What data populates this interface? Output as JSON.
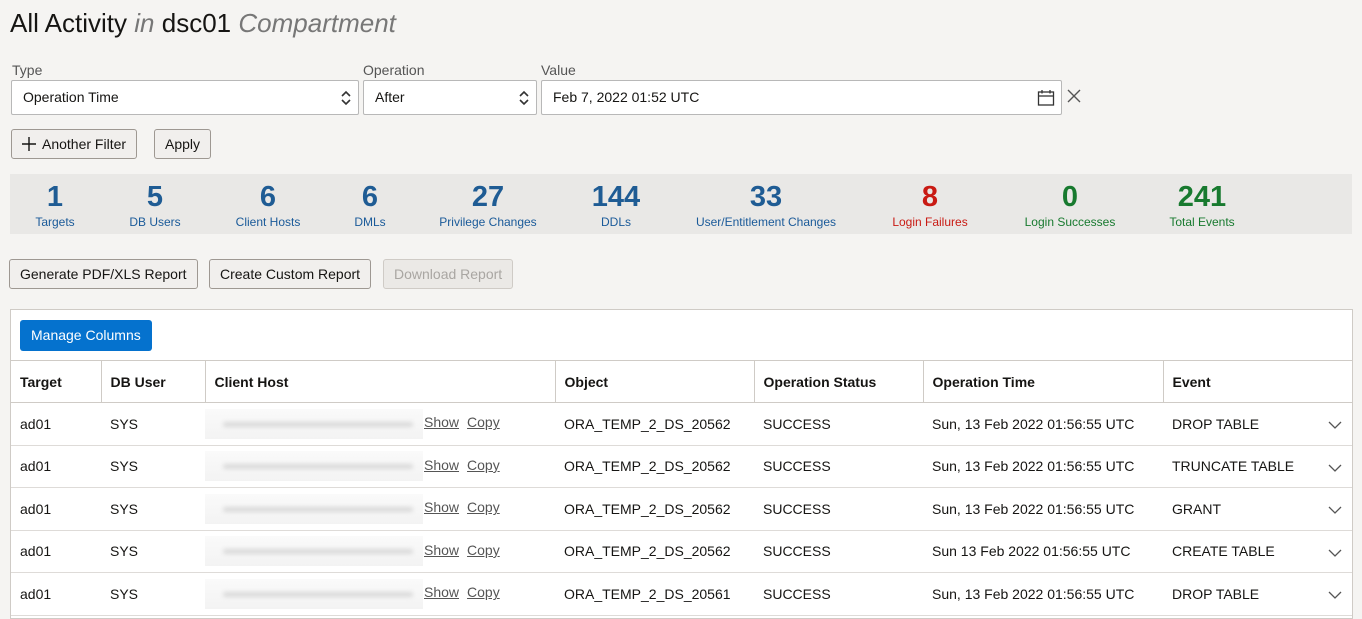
{
  "header": {
    "title_main": "All Activity",
    "title_in": "in",
    "compartment": "dsc01",
    "compartment_suffix": "Compartment"
  },
  "filters": {
    "type_label": "Type",
    "type_value": "Operation Time",
    "operation_label": "Operation",
    "operation_value": "After",
    "value_label": "Value",
    "value_value": "Feb 7, 2022 01:52 UTC"
  },
  "actions": {
    "another_filter": "Another Filter",
    "apply": "Apply",
    "generate_report": "Generate PDF/XLS Report",
    "create_custom_report": "Create Custom Report",
    "download_report": "Download Report",
    "manage_columns": "Manage Columns"
  },
  "stats": [
    {
      "value": "1",
      "label": "Targets"
    },
    {
      "value": "5",
      "label": "DB Users"
    },
    {
      "value": "6",
      "label": "Client Hosts"
    },
    {
      "value": "6",
      "label": "DMLs"
    },
    {
      "value": "27",
      "label": "Privilege Changes"
    },
    {
      "value": "144",
      "label": "DDLs"
    },
    {
      "value": "33",
      "label": "User/Entitlement Changes"
    },
    {
      "value": "8",
      "label": "Login Failures"
    },
    {
      "value": "0",
      "label": "Login Successes"
    },
    {
      "value": "241",
      "label": "Total Events"
    }
  ],
  "colors": {
    "accent": "#0572ce",
    "stat_blue": "#1f5c94",
    "stat_red": "#c91a13",
    "stat_green": "#187a2f"
  },
  "table": {
    "columns": [
      "Target",
      "DB User",
      "Client Host",
      "Object",
      "Operation Status",
      "Operation Time",
      "Event"
    ],
    "show_link": "Show",
    "copy_link": "Copy",
    "rows": [
      {
        "target": "ad01",
        "db_user": "SYS",
        "object": "ORA_TEMP_2_DS_20562",
        "status": "SUCCESS",
        "time": "Sun, 13 Feb 2022 01:56:55 UTC",
        "event": "DROP TABLE"
      },
      {
        "target": "ad01",
        "db_user": "SYS",
        "object": "ORA_TEMP_2_DS_20562",
        "status": "SUCCESS",
        "time": "Sun, 13 Feb 2022 01:56:55 UTC",
        "event": "TRUNCATE TABLE"
      },
      {
        "target": "ad01",
        "db_user": "SYS",
        "object": "ORA_TEMP_2_DS_20562",
        "status": "SUCCESS",
        "time": "Sun, 13 Feb 2022 01:56:55 UTC",
        "event": "GRANT"
      },
      {
        "target": "ad01",
        "db_user": "SYS",
        "object": "ORA_TEMP_2_DS_20562",
        "status": "SUCCESS",
        "time": "Sun 13 Feb 2022 01:56:55 UTC",
        "event": "CREATE TABLE"
      },
      {
        "target": "ad01",
        "db_user": "SYS",
        "object": "ORA_TEMP_2_DS_20561",
        "status": "SUCCESS",
        "time": "Sun, 13 Feb 2022 01:56:55 UTC",
        "event": "DROP TABLE"
      }
    ]
  }
}
